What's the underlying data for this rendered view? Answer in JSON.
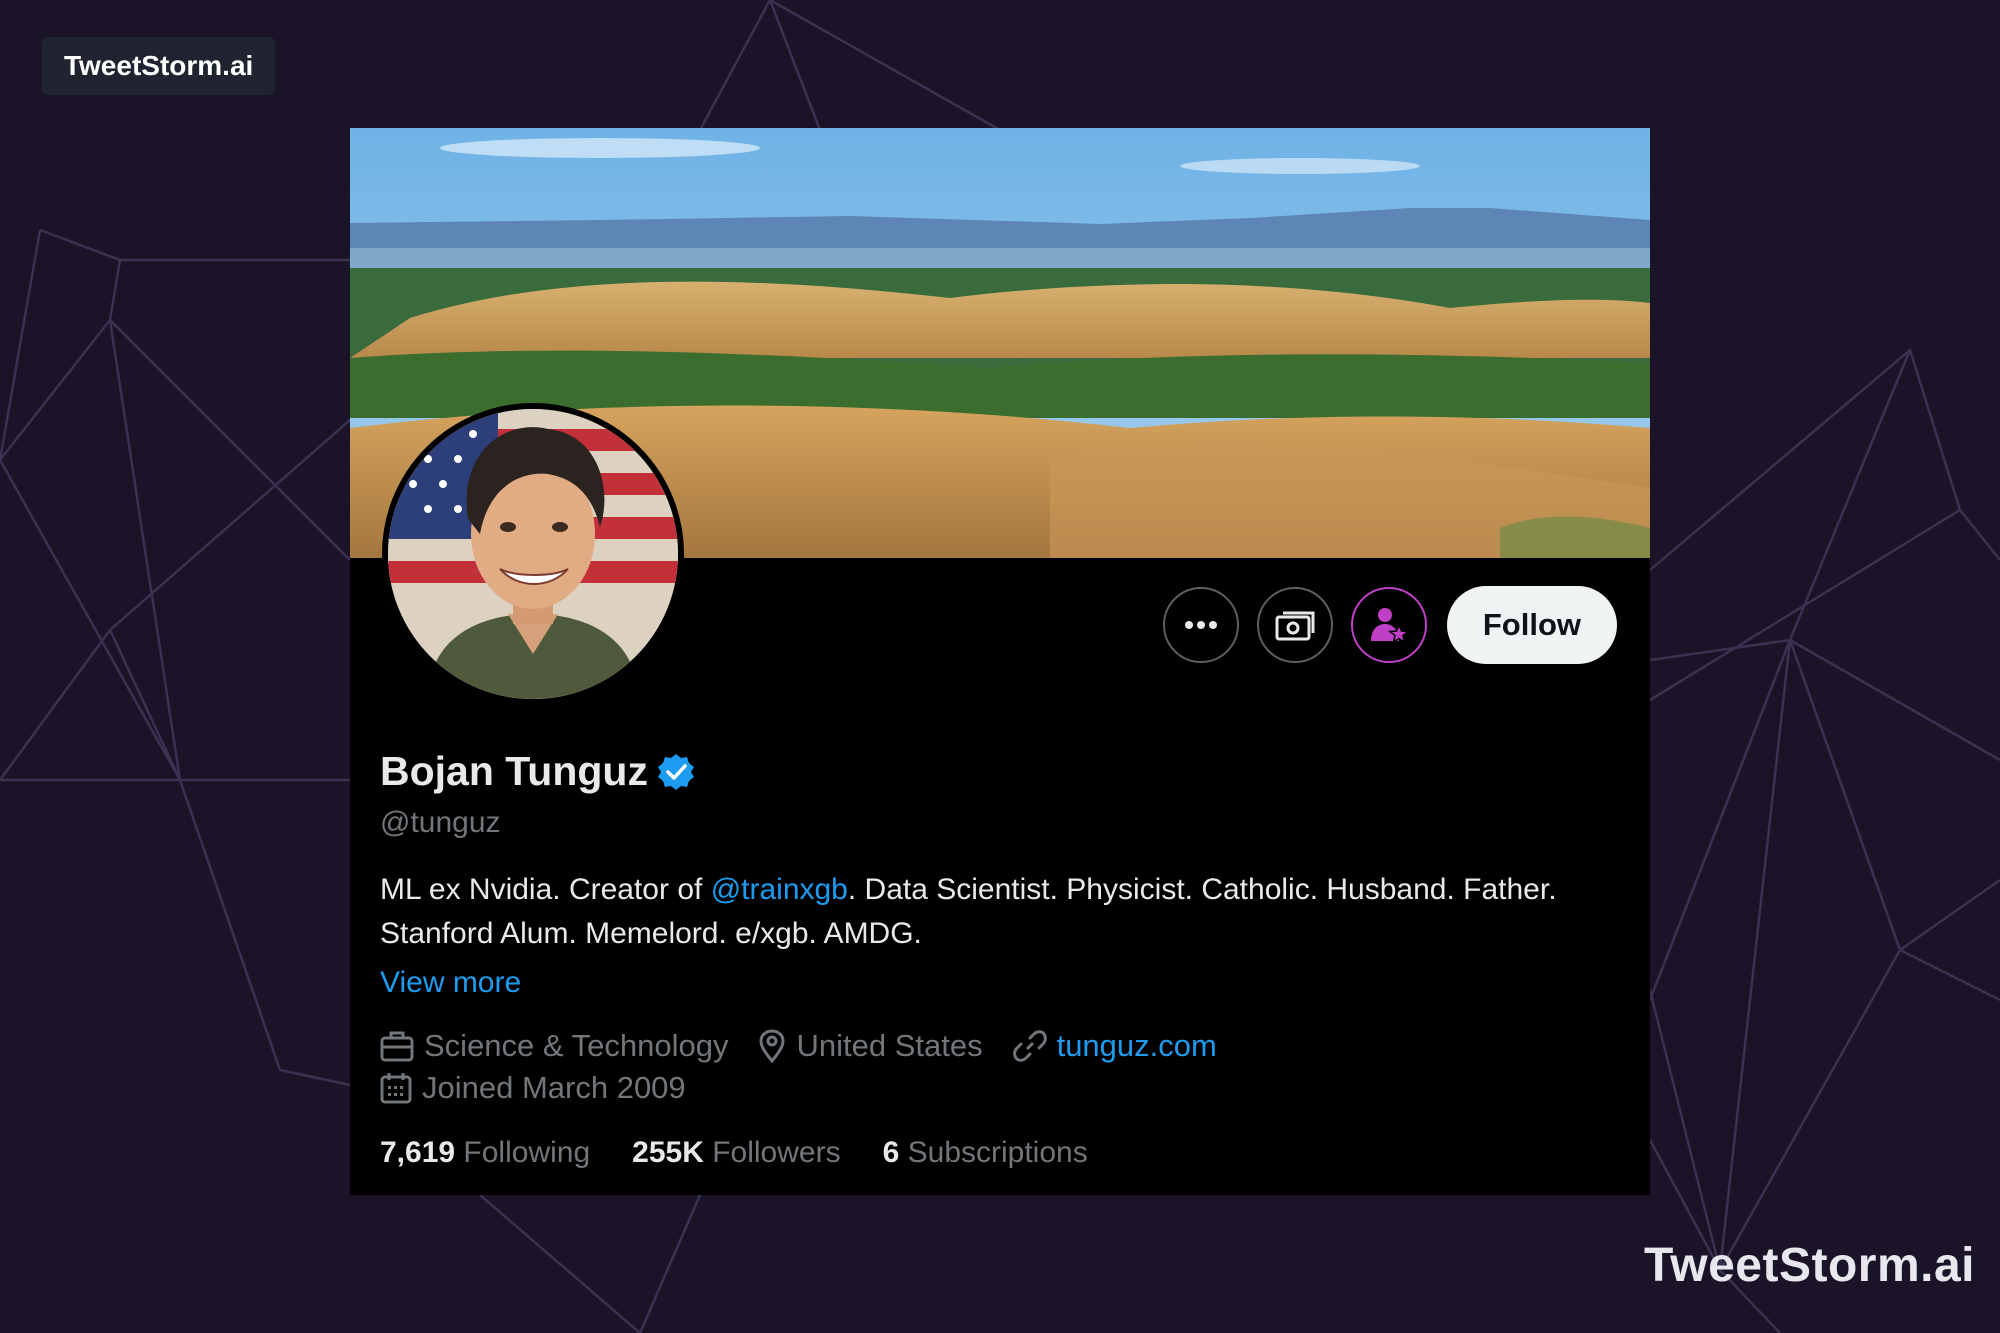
{
  "brand": {
    "badge": "TweetStorm.ai",
    "watermark": "TweetStorm.ai"
  },
  "profile": {
    "display_name": "Bojan Tunguz",
    "handle": "@tunguz",
    "verified_icon": "verified-badge-icon",
    "bio_part1": "ML ex Nvidia. Creator of ",
    "bio_mention": "@trainxgb",
    "bio_part2": ". Data Scientist. Physicist. Catholic. Husband. Father. Stanford Alum. Memelord. e/xgb. AMDG.",
    "view_more": "View more",
    "category": "Science & Technology",
    "location": "United States",
    "website": "tunguz.com",
    "joined": "Joined March 2009"
  },
  "actions": {
    "more_icon": "more-options-icon",
    "subscribe_icon": "subscription-icon",
    "follow_label": "Follow"
  },
  "stats": {
    "following_count": "7,619",
    "following_label": "Following",
    "followers_count": "255K",
    "followers_label": "Followers",
    "subscriptions_count": "6",
    "subscriptions_label": "Subscriptions"
  },
  "colors": {
    "accent": "#1d9bf0",
    "subscribe": "#c03fc7",
    "background": "#1b1429"
  }
}
